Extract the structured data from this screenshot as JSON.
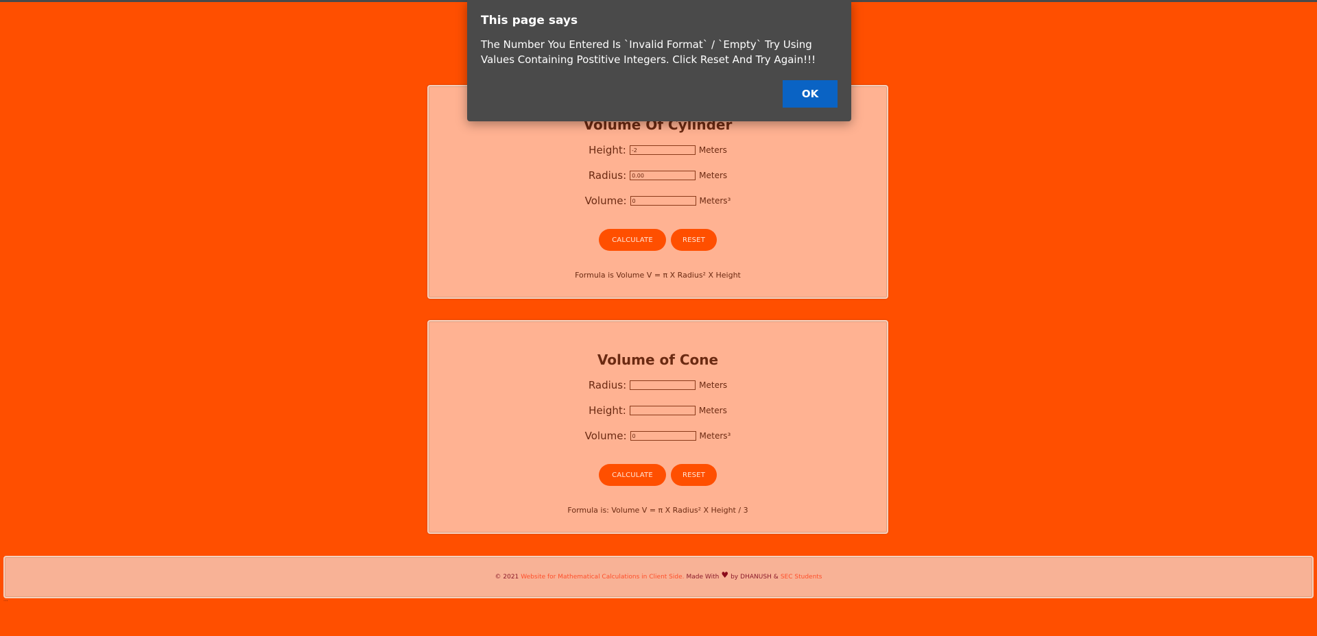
{
  "cylinder": {
    "title": "Volume Of Cylinder",
    "height_label": "Height:",
    "height_value": "-2",
    "radius_label": "Radius:",
    "radius_value": "0.00",
    "volume_label": "Volume:",
    "volume_value": "0",
    "unit": "Meters",
    "volume_unit": "Meters³",
    "calculate_label": "CALCULATE",
    "reset_label": "RESET",
    "formula": "Formula is Volume V = π X Radius² X Height"
  },
  "cone": {
    "title": "Volume of Cone",
    "radius_label": "Radius:",
    "radius_value": "",
    "height_label": "Height:",
    "height_value": "",
    "volume_label": "Volume:",
    "volume_value": "0",
    "unit": "Meters",
    "volume_unit": "Meters³",
    "calculate_label": "CALCULATE",
    "reset_label": "RESET",
    "formula": "Formula is: Volume V = π X Radius² X Height / 3"
  },
  "footer": {
    "copyright": "© 2021",
    "site_link": "Website for Mathematical Calculations in Client Side.",
    "made_with": "Made With",
    "heart": "♥",
    "by": "by",
    "author": "DHANUSH",
    "amp": "&",
    "students_link": "SEC Students",
    "dots": "..."
  },
  "dialog": {
    "title": "This page says",
    "message": "The Number You Entered Is `Invalid Format` / `Empty` Try Using Values Containing Postitive Integers. Click Reset And Try Again!!!",
    "ok_label": "OK"
  },
  "colors": {
    "background": "#ff4f00",
    "card": "#ffb292",
    "button": "#ff4f00",
    "dialog": "#4a4a4a",
    "dialog_ok": "#0a63c4"
  }
}
